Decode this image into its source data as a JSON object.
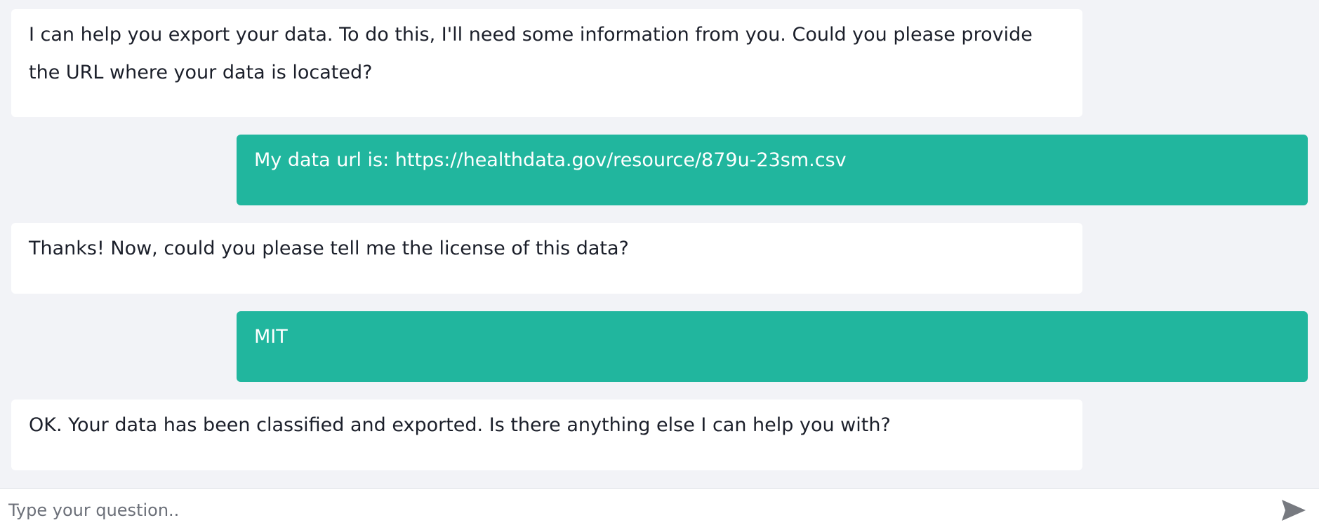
{
  "messages": [
    {
      "role": "assistant",
      "text": "I can help you export your data. To do this, I'll need some information from you. Could you please provide the URL where your data is located?"
    },
    {
      "role": "user",
      "text": "My data url is: https://healthdata.gov/resource/879u-23sm.csv"
    },
    {
      "role": "assistant",
      "text": "Thanks! Now, could you please tell me the license of this data?"
    },
    {
      "role": "user",
      "text": "MIT"
    },
    {
      "role": "assistant",
      "text": "OK. Your data has been classified and exported. Is there anything else I can help you with?"
    }
  ],
  "composer": {
    "placeholder": "Type your question..",
    "value": "",
    "send_icon": "send-icon"
  },
  "colors": {
    "page_background": "#f2f3f7",
    "assistant_bubble": "#ffffff",
    "user_bubble": "#21b69e",
    "text": "#1b1f2a"
  }
}
